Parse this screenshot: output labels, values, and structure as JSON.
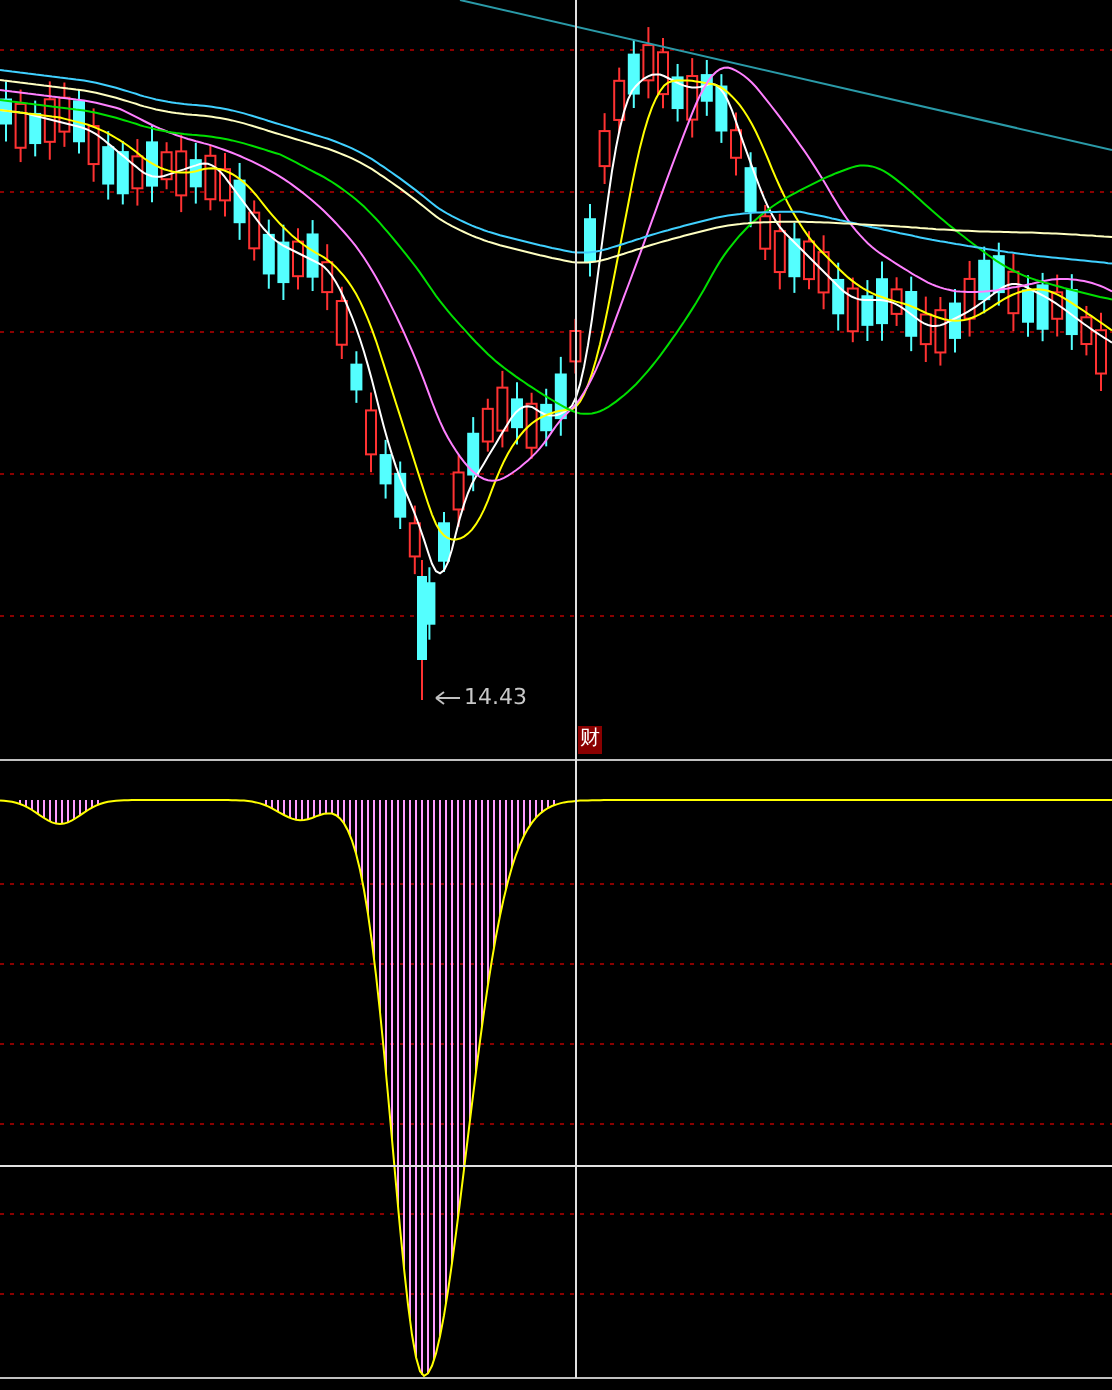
{
  "price_panel": {
    "low_price_label": "14.43",
    "event_marker": "财"
  }
}
